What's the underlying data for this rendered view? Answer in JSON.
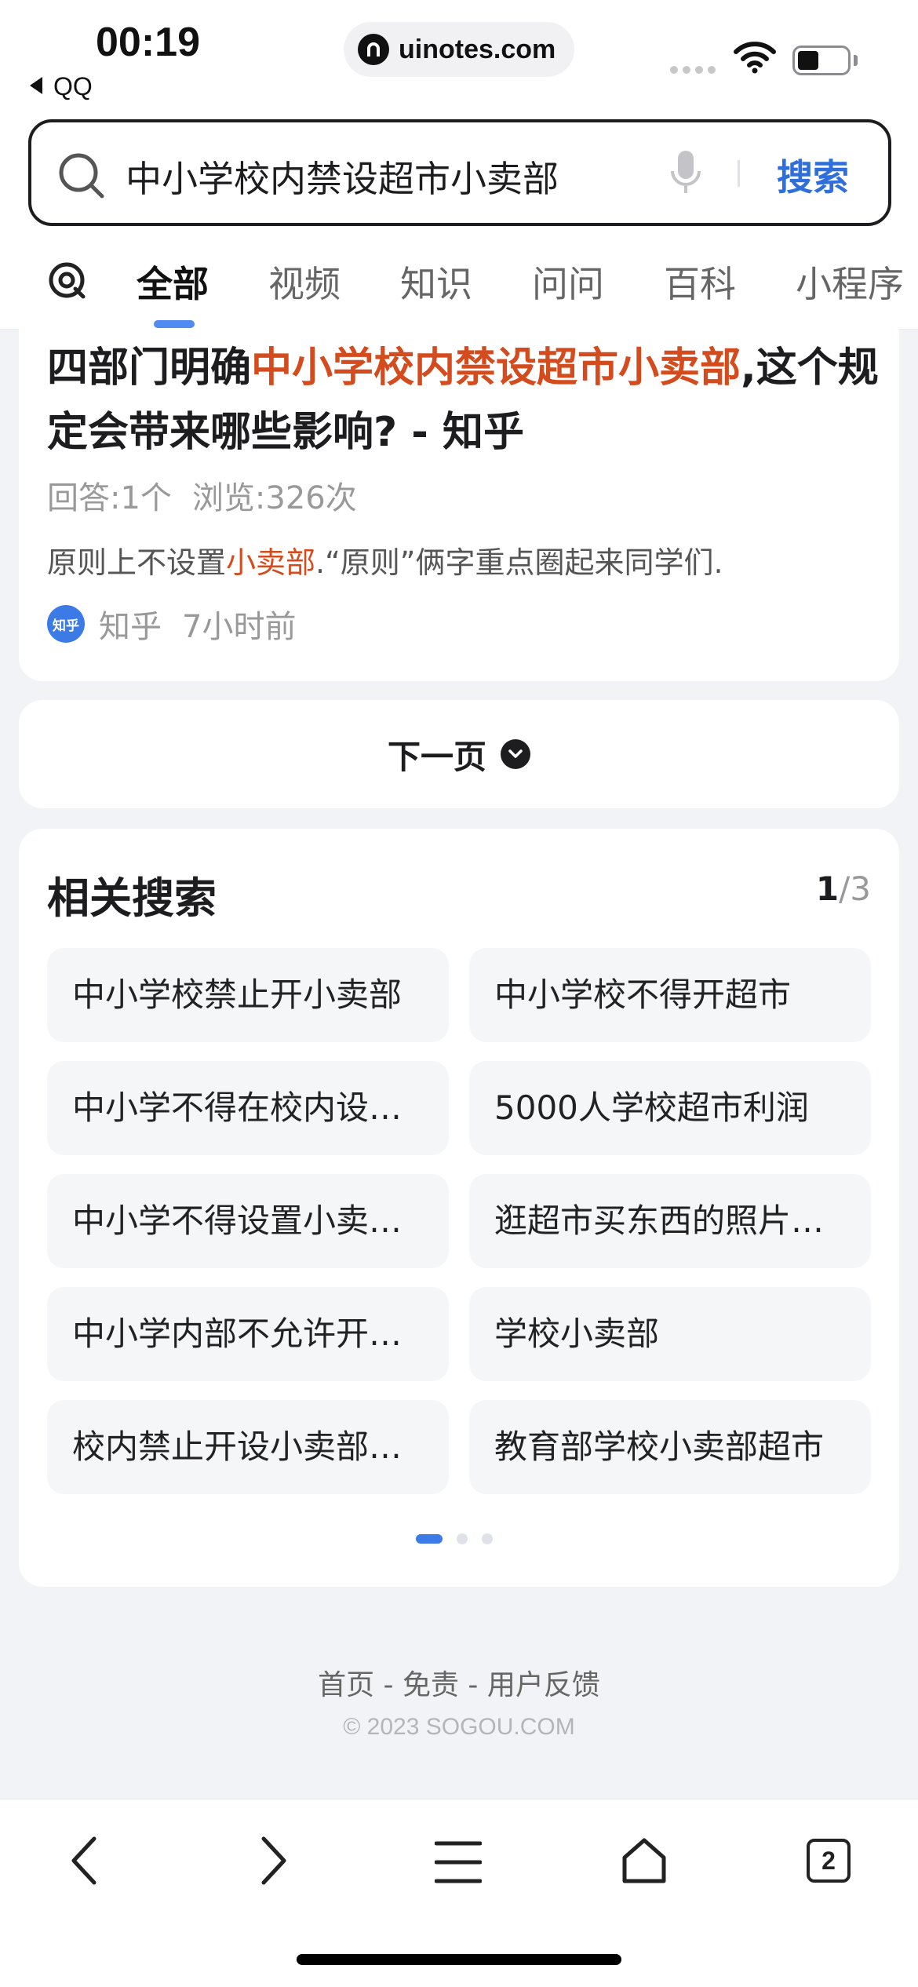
{
  "status_bar": {
    "time": "00:19",
    "back_app": "QQ",
    "url": "uinotes.com"
  },
  "search": {
    "query": "中小学校内禁设超市小卖部",
    "button_label": "搜索"
  },
  "tabs": [
    {
      "label": "全部",
      "active": true
    },
    {
      "label": "视频"
    },
    {
      "label": "知识"
    },
    {
      "label": "问问"
    },
    {
      "label": "百科"
    },
    {
      "label": "小程序"
    }
  ],
  "result": {
    "title_pre": "四部门明确",
    "title_highlight": "中小学校内禁设超市小卖部",
    "title_post": ",这个规定会带来哪些影响? - 知乎",
    "answers": "回答:1个",
    "views": "浏览:326次",
    "snippet_pre": "原则上不设置",
    "snippet_highlight": "小卖部",
    "snippet_post": ".“原则”俩字重点圈起来同学们.",
    "source_logo": "知乎",
    "source": "知乎",
    "time": "7小时前"
  },
  "next_page": {
    "label": "下一页"
  },
  "related": {
    "title": "相关搜索",
    "page_current": "1",
    "page_total": "/3",
    "items": [
      "中小学校禁止开小卖部",
      "中小学校不得开超市",
      "中小学不得在校内设…",
      "5000人学校超市利润",
      "中小学不得设置小卖…",
      "逛超市买东西的照片…",
      "中小学内部不允许开…",
      "学校小卖部",
      "校内禁止开设小卖部…",
      "教育部学校小卖部超市"
    ]
  },
  "footer": {
    "links": "首页 - 免责 - 用户反馈",
    "copyright": "© 2023 SOGOU.COM"
  },
  "toolbar": {
    "tab_count": "2"
  },
  "colors": {
    "accent": "#2f6fdb",
    "highlight": "#d44c1e",
    "page_bg": "#f2f3f6"
  }
}
